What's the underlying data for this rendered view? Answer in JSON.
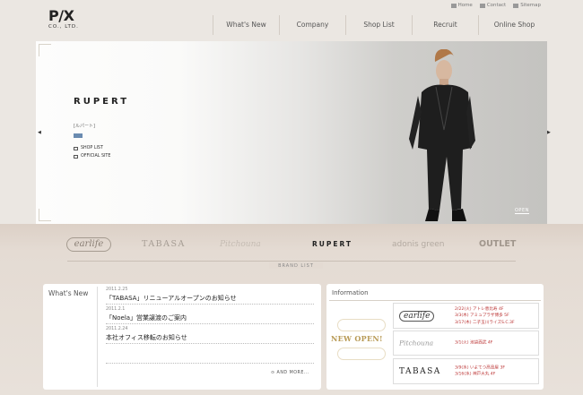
{
  "header": {
    "logo_main": "P/X",
    "logo_sub": "CO., LTD.",
    "util_links": [
      {
        "label": "Home",
        "icon": "home-icon"
      },
      {
        "label": "Contact",
        "icon": "mail-icon"
      },
      {
        "label": "Sitemap",
        "icon": "sitemap-icon"
      }
    ],
    "nav": [
      "What's New",
      "Company",
      "Shop List",
      "Recruit",
      "Online Shop"
    ]
  },
  "hero": {
    "brand": "RUPERT",
    "kana": "[ルパート]",
    "links": [
      "SHOP LIST",
      "OFFICIAL SITE"
    ],
    "open_label": "OPEN",
    "prev_arrow": "◀",
    "next_arrow": "▶"
  },
  "brands": {
    "items": [
      "earlife",
      "TABASA",
      "Pitchouna",
      "RUPERT",
      "adonis green",
      "OUTLET"
    ],
    "caption": "BRAND LIST"
  },
  "whats_new": {
    "title": "What's New",
    "items": [
      {
        "date": "2011.2.25",
        "text": "「TABASA」リニューアルオープンのお知らせ"
      },
      {
        "date": "2011.2.1",
        "text": "「Noela」営業譲渡のご案内"
      },
      {
        "date": "2011.2.24",
        "text": "本社オフィス移転のお知らせ"
      }
    ],
    "more": "AND MORE..."
  },
  "information": {
    "title": "Information",
    "new_open": "NEW OPEN!",
    "entries": [
      {
        "brand": "earlife",
        "lines": [
          "2/22(火) アトレ恵比寿 4F",
          "3/3(木) アミュプラザ博多 5F",
          "3/17(木) 二子玉川ライズS.C.3F"
        ]
      },
      {
        "brand": "Pitchouna",
        "lines": [
          "3/1(火) 池袋西武 4F"
        ]
      },
      {
        "brand": "TABASA",
        "lines": [
          "3/9(水) いよてつ髙島屋 3F",
          "3/16(水) 神戸大丸 4F"
        ]
      }
    ]
  },
  "colors": {
    "accent_gold": "#b89a55",
    "date_red": "#b33333"
  }
}
